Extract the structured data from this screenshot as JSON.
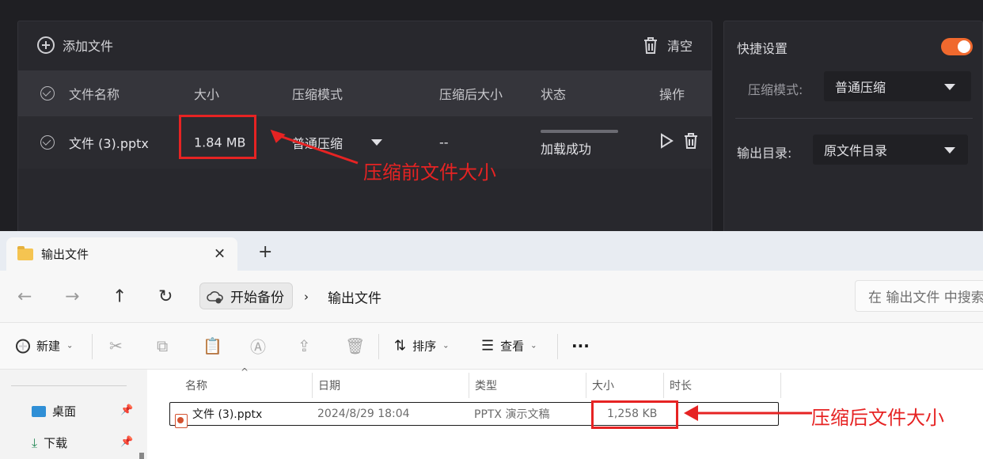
{
  "app": {
    "toolbar": {
      "add_file": "添加文件",
      "clear": "清空"
    },
    "table": {
      "headers": {
        "name": "文件名称",
        "size": "大小",
        "mode": "压缩模式",
        "compressed_size": "压缩后大小",
        "status": "状态",
        "action": "操作"
      },
      "rows": [
        {
          "name": "文件 (3).pptx",
          "size": "1.84 MB",
          "mode": "普通压缩",
          "compressed_size": "--",
          "status": "加载成功",
          "progress": 1.0
        }
      ]
    },
    "settings": {
      "title": "快捷设置",
      "quick_settings_enabled": true,
      "mode_label": "压缩模式:",
      "mode_value": "普通压缩",
      "output_label": "输出目录:",
      "output_value": "原文件目录"
    }
  },
  "annotations": {
    "before": "压缩前文件大小",
    "after": "压缩后文件大小",
    "color": "#e62323"
  },
  "explorer": {
    "tab_title": "输出文件",
    "breadcrumb": [
      "开始备份",
      "输出文件"
    ],
    "search_placeholder": "在 输出文件 中搜索",
    "commands": {
      "new": "新建",
      "sort": "排序",
      "view": "查看",
      "more": "···"
    },
    "sidebar": [
      {
        "label": "桌面",
        "icon": "desktop-icon"
      },
      {
        "label": "下载",
        "icon": "download-icon"
      }
    ],
    "columns": {
      "name": "名称",
      "date": "日期",
      "type": "类型",
      "size": "大小",
      "duration": "时长"
    },
    "files": [
      {
        "name": "文件 (3).pptx",
        "date": "2024/8/29 18:04",
        "type": "PPTX 演示文稿",
        "size": "1,258 KB"
      }
    ]
  }
}
